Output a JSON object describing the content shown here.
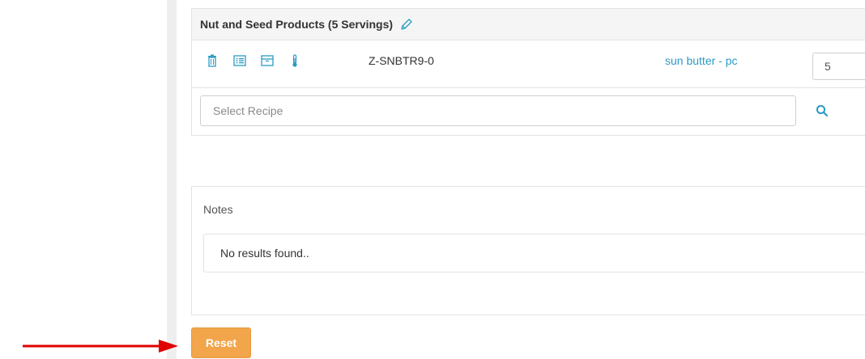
{
  "recipe_group": {
    "title": "Nut and Seed Products (5 Servings)",
    "rows": [
      {
        "code": "Z-SNBTR9-0",
        "name": "sun butter - pc",
        "quantity": "5"
      }
    ],
    "select_placeholder": "Select Recipe"
  },
  "notes": {
    "title": "Notes",
    "empty_text": "No results found.."
  },
  "actions": {
    "reset_label": "Reset"
  },
  "colors": {
    "link": "#2b9ac4",
    "icon": "#2b9ac4",
    "reset_button": "#f2a54a",
    "annotation_arrow": "#e00000"
  },
  "icons": [
    "pencil-icon",
    "trash-icon",
    "list-icon",
    "archive-icon",
    "thermometer-icon",
    "search-icon",
    "arrow-icon"
  ]
}
